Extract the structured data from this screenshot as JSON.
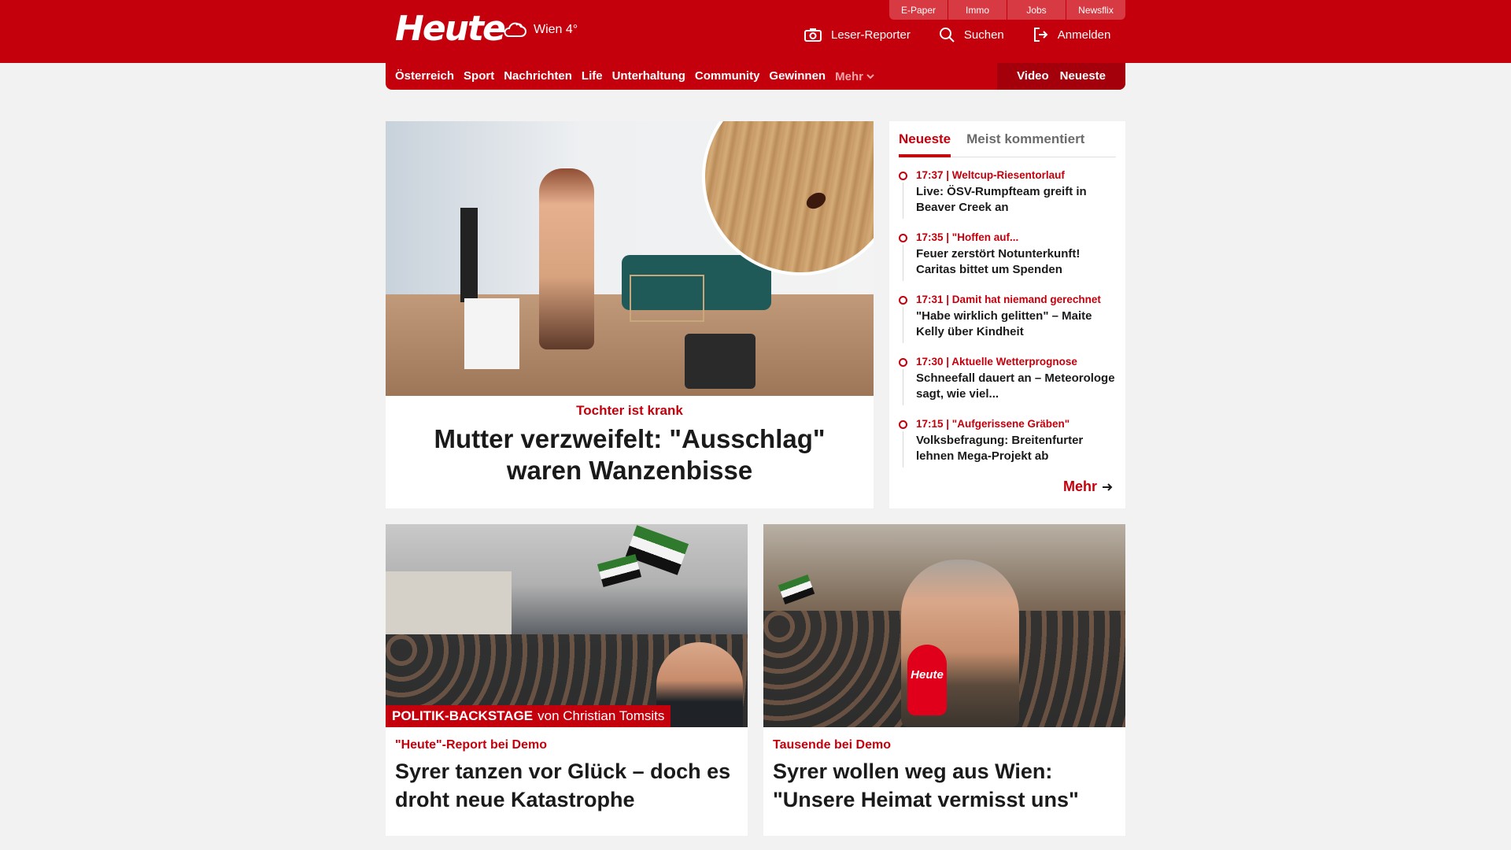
{
  "header": {
    "util_tabs": [
      "E-Paper",
      "Immo",
      "Jobs",
      "Newsflix"
    ],
    "logo": "Heute",
    "weather": "Wien 4°",
    "actions": {
      "reporter": "Leser-Reporter",
      "search": "Suchen",
      "login": "Anmelden"
    }
  },
  "nav": {
    "items": [
      "Österreich",
      "Sport",
      "Nachrichten",
      "Life",
      "Unterhaltung",
      "Community",
      "Gewinnen"
    ],
    "more": "Mehr",
    "right": [
      "Video",
      "Neueste"
    ]
  },
  "hero": {
    "kicker": "Tochter ist krank",
    "title": "Mutter verzweifelt: \"Ausschlag\" waren Wanzenbisse"
  },
  "sidebar": {
    "tabs": [
      "Neueste",
      "Meist kommentiert"
    ],
    "items": [
      {
        "meta": "17:37 | Weltcup-Riesentorlauf",
        "title": "Live: ÖSV-Rumpfteam greift in Beaver Creek an"
      },
      {
        "meta": "17:35 | \"Hoffen auf...",
        "title": "Feuer zerstört Notunterkunft! Caritas bittet um Spenden"
      },
      {
        "meta": "17:31 | Damit hat niemand gerechnet",
        "title": "\"Habe wirklich gelitten\" – Maite Kelly über Kindheit"
      },
      {
        "meta": "17:30 | Aktuelle Wetterprognose",
        "title": "Schneefall dauert an – Meteorologe sagt, wie viel..."
      },
      {
        "meta": "17:15 | \"Aufgerissene Gräben\"",
        "title": "Volksbefragung: Breitenfurter lehnen Mega-Projekt ab"
      }
    ],
    "more": "Mehr"
  },
  "cards": [
    {
      "ribbon_bold": "POLITIK-BACKSTAGE",
      "ribbon_rest": "von Christian Tomsits",
      "kicker": "\"Heute\"-Report bei Demo",
      "title": "Syrer tanzen vor Glück – doch es droht neue Katastrophe"
    },
    {
      "mic_label": "Heute",
      "kicker": "Tausende bei Demo",
      "title": "Syrer wollen weg aus Wien: \"Unsere Heimat vermisst uns\""
    }
  ],
  "colors": {
    "brand": "#c5000d",
    "background": "#f2f2f2"
  },
  "icons": [
    "cloud-icon",
    "camera-icon",
    "search-icon",
    "login-icon",
    "chevron-down-icon",
    "arrow-right-icon"
  ]
}
